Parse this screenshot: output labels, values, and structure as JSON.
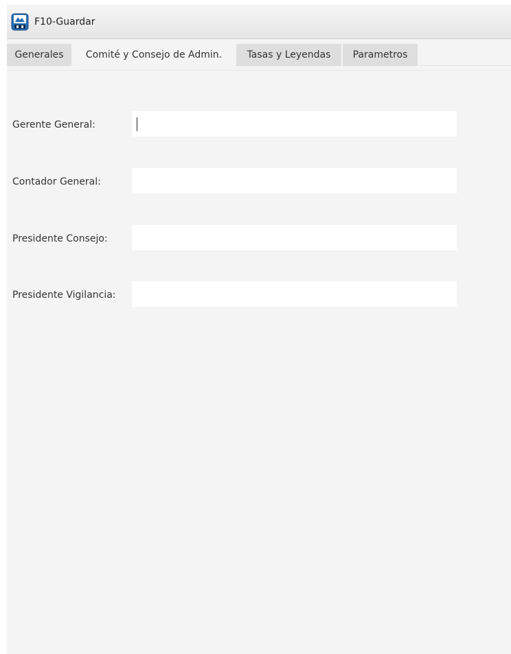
{
  "toolbar": {
    "save_label": "F10-Guardar",
    "save_icon": "save-disk-icon"
  },
  "tabs": [
    {
      "label": "Generales",
      "active": false
    },
    {
      "label": "Comité y Consejo de Admin.",
      "active": true
    },
    {
      "label": "Tasas y Leyendas",
      "active": false
    },
    {
      "label": "Parametros",
      "active": false
    }
  ],
  "form": {
    "fields": [
      {
        "label": "Gerente General:",
        "value": "",
        "focused": true
      },
      {
        "label": "Contador General:",
        "value": ""
      },
      {
        "label": "Presidente Consejo:",
        "value": ""
      },
      {
        "label": "Presidente Vigilancia:",
        "value": ""
      }
    ]
  },
  "colors": {
    "background": "#f4f4f4",
    "tab_inactive": "#dedede",
    "field_bg": "#ffffff"
  }
}
